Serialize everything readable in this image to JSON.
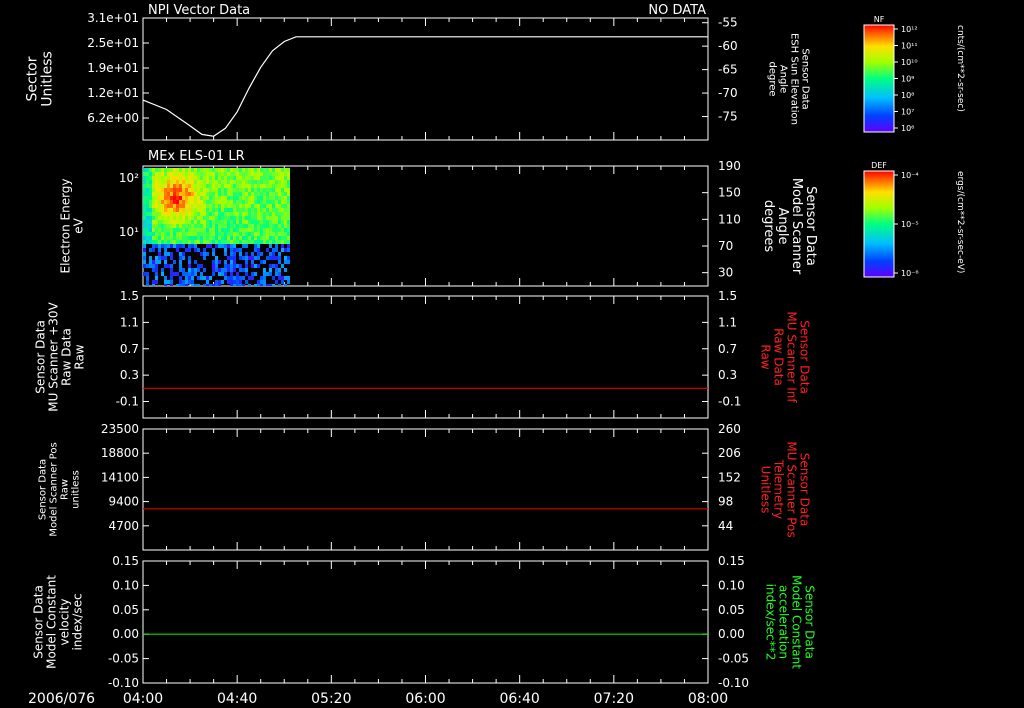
{
  "date_label": "2006/076",
  "colors": {
    "background": "#000000",
    "foreground": "#ffffff",
    "red_series": "#e00000",
    "green_series": "#00e000",
    "red_text": "#ff2020",
    "green_text": "#20ff20"
  },
  "chart_data": [
    {
      "type": "line",
      "title": "NPI Vector Data",
      "status": "NO DATA",
      "ylabel_left": [
        "Sector",
        "Unitless"
      ],
      "yticks_left": [
        "3.1e+01",
        "2.5e+01",
        "1.9e+01",
        "1.2e+01",
        "6.2e+00"
      ],
      "ylabel_right": [
        "Sensor Data",
        "ESH Sun Elevation",
        "Angle",
        "degree"
      ],
      "yticks_right": [
        "-55",
        "-60",
        "-65",
        "-70",
        "-75"
      ],
      "yticks_right_values": [
        -55,
        -60,
        -65,
        -70,
        -75
      ],
      "ylim_right": [
        -80,
        -54
      ],
      "series": [
        {
          "x": [
            "04:00",
            "04:10",
            "04:20",
            "04:25",
            "04:30",
            "04:35",
            "04:40",
            "04:45",
            "04:50",
            "04:55",
            "05:00",
            "05:05",
            "05:10",
            "05:30",
            "06:00",
            "07:00",
            "08:00"
          ],
          "y": [
            -71.5,
            -73.5,
            -77,
            -78.8,
            -79.2,
            -77.5,
            -74,
            -69,
            -64.5,
            -61,
            -59,
            -58,
            -58,
            -58,
            -58,
            -58,
            -58
          ]
        }
      ]
    },
    {
      "type": "heatmap",
      "title": "MEx ELS-01 LR",
      "ylabel_left": [
        "Electron Energy",
        "eV"
      ],
      "yticks_left": [
        "10²",
        "10¹"
      ],
      "ylabel_right": [
        "Sensor Data",
        "Model Scanner",
        "Angle",
        "degrees"
      ],
      "yticks_right": [
        "190",
        "150",
        "110",
        "70",
        "30"
      ],
      "ylim_right": [
        10,
        190
      ],
      "x_range": [
        "04:00",
        "05:02"
      ]
    },
    {
      "type": "line",
      "ylabel_left": [
        "Sensor Data",
        "MU Scanner +30V",
        "Raw Data",
        "Raw"
      ],
      "yticks_left": [
        "1.5",
        "1.1",
        "0.7",
        "0.3",
        "-0.1"
      ],
      "yticks_left_values": [
        1.5,
        1.1,
        0.7,
        0.3,
        -0.1
      ],
      "ylim": [
        -0.35,
        1.5
      ],
      "ylabel_right": [
        "Sensor Data",
        "MU Scanner Inf",
        "Raw Data",
        "Raw"
      ],
      "yticks_right": [
        "1.5",
        "1.1",
        "0.7",
        "0.3",
        "-0.1"
      ],
      "series": [
        {
          "x": [
            "04:00",
            "08:00"
          ],
          "y": [
            0.1,
            0.1
          ]
        }
      ]
    },
    {
      "type": "line",
      "ylabel_left": [
        "Sensor Data",
        "Model Scanner Pos",
        "Raw",
        "unitless"
      ],
      "yticks_left": [
        "23500",
        "18800",
        "14100",
        "9400",
        "4700"
      ],
      "yticks_left_values": [
        23500,
        18800,
        14100,
        9400,
        4700
      ],
      "ylim": [
        0,
        23500
      ],
      "ylabel_right": [
        "Sensor Data",
        "MU Scanner Pos",
        "Telemetry",
        "Unitless"
      ],
      "yticks_right": [
        "260",
        "206",
        "152",
        "98",
        "44"
      ],
      "series": [
        {
          "x": [
            "04:00",
            "08:00"
          ],
          "y": [
            8000,
            8000
          ]
        }
      ]
    },
    {
      "type": "line",
      "ylabel_left": [
        "Sensor Data",
        "Model Constant",
        "velocity",
        "index/sec"
      ],
      "yticks_left": [
        "0.15",
        "0.10",
        "0.05",
        "0.00",
        "-0.05",
        "-0.10"
      ],
      "yticks_left_values": [
        0.15,
        0.1,
        0.05,
        0.0,
        -0.05,
        -0.1
      ],
      "ylim": [
        -0.1,
        0.15
      ],
      "ylabel_right": [
        "Sensor Data",
        "Model Constant",
        "acceleration",
        "index/sec**2"
      ],
      "yticks_right": [
        "0.15",
        "0.10",
        "0.05",
        "0.00",
        "-0.05",
        "-0.10"
      ],
      "series": [
        {
          "x": [
            "04:00",
            "08:00"
          ],
          "y": [
            0.0,
            0.0
          ]
        }
      ]
    }
  ],
  "x_axis": {
    "ticks": [
      "04:00",
      "04:40",
      "05:20",
      "06:00",
      "06:40",
      "07:20",
      "08:00"
    ],
    "range": [
      "04:00",
      "08:00"
    ]
  },
  "colorbars": [
    {
      "title": "NF",
      "unit": "cnts/(cm**2-sr-sec)",
      "ticks": [
        "10¹²",
        "10¹¹",
        "10¹⁰",
        "10⁹",
        "10⁸",
        "10⁷",
        "10⁶"
      ]
    },
    {
      "title": "DEF",
      "unit": "ergs/(cm**2-sr-sec-eV)",
      "ticks": [
        "10⁻⁴",
        "10⁻⁵",
        "10⁻⁶"
      ]
    }
  ]
}
